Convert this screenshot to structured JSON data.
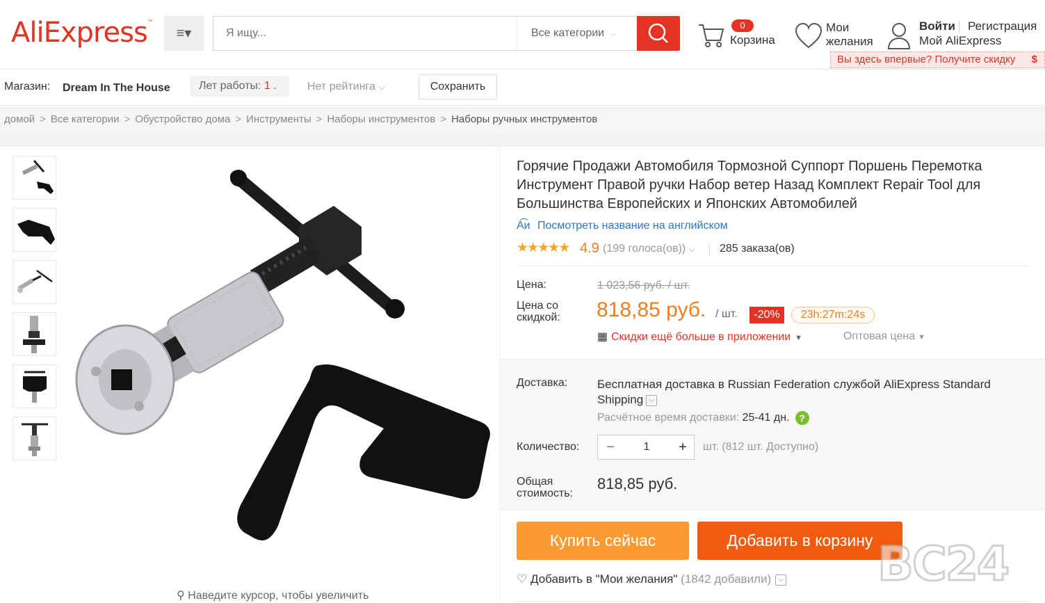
{
  "header": {
    "logo_text": "AliExpress",
    "logo_tm": "™",
    "search_placeholder": "Я ищу...",
    "search_category": "Все категории",
    "cart_count": "0",
    "cart_label": "Корзина",
    "wishlist_label": "Мои желания",
    "signin_label": "Войти",
    "register_label": "Регистрация",
    "my_account_label": "Мой AliExpress",
    "promo_text": "Вы здесь впервые? Получите скидку",
    "promo_symbol": "$",
    "accent_color": "#e43225"
  },
  "store": {
    "label": "Магазин:",
    "name": "Dream In The House",
    "years_label": "Лет работы:",
    "years_value": "1 .",
    "rating_label": "Нет рейтинга",
    "save_label": "Сохранить"
  },
  "breadcrumb": {
    "items": [
      "домой",
      "Все категории",
      "Обустройство дома",
      "Инструменты",
      "Наборы инструментов",
      "Наборы ручных инструментов"
    ],
    "separator": ">"
  },
  "gallery": {
    "thumbnail_count": 6,
    "zoom_hint": "Наведите курсор, чтобы увеличить"
  },
  "product": {
    "title": "Горячие Продажи Автомобиля Тормозной Суппорт Поршень Перемотка Инструмент Правой ручки Набор ветер Назад Комплект Repair Tool для Большинства Европейских и Японских Автомобилей",
    "translate_link": "Посмотреть название на английском",
    "rating_stars": 4.9,
    "rating_value": "4.9",
    "votes": "(199 голоса(ов))",
    "orders": "285 заказа(ов)"
  },
  "price": {
    "price_label": "Цена:",
    "old_price": "1 023,56 руб. / шт.",
    "discount_label": "Цена со скидкой:",
    "new_price": "818,85 руб.",
    "unit": "/ шт.",
    "discount_badge": "-20%",
    "timer": "23h:27m:24s",
    "app_promo": "Скидки ещё больше в приложении",
    "wholesale": "Оптовая цена"
  },
  "shipping": {
    "label": "Доставка:",
    "text_bold": "Бесплатная доставка в",
    "text_rest": "Russian Federation службой AliExpress Standard Shipping",
    "time_label": "Расчётное время доставки:",
    "time_value": "25-41 дн.",
    "help_symbol": "?"
  },
  "quantity": {
    "label": "Количество:",
    "minus": "−",
    "value": "1",
    "plus": "+",
    "available": "шт. (812 шт. Доступно)"
  },
  "total": {
    "label": "Общая стоимость:",
    "value": "818,85 руб."
  },
  "actions": {
    "buy_now": "Купить сейчас",
    "add_to_cart": "Добавить в корзину",
    "wishlist_text": "Добавить в \"Мои желания\"",
    "wishlist_count": "(1842 добавили)"
  },
  "watermark": "BC24"
}
